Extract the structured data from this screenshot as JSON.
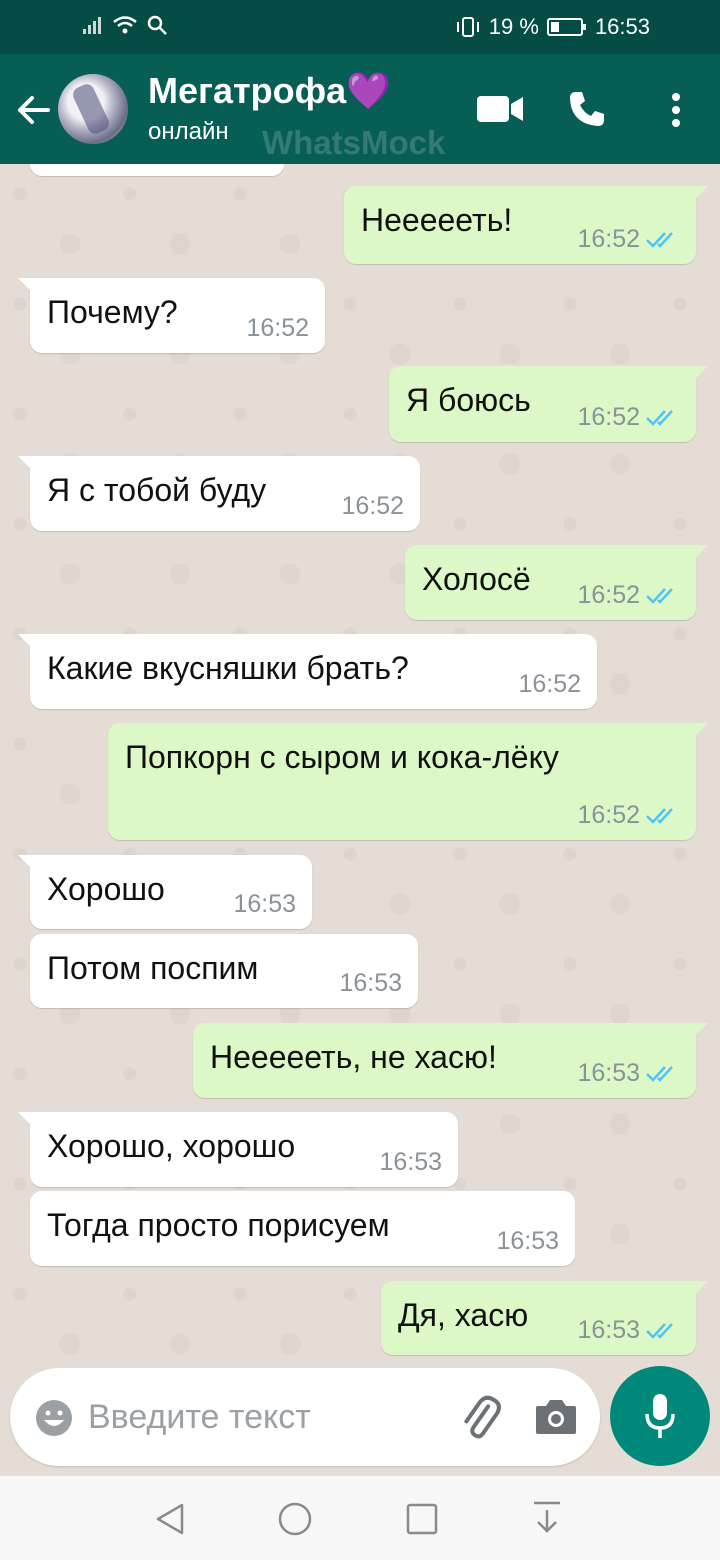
{
  "status_bar": {
    "battery_percent": "19 %",
    "time": "16:53"
  },
  "header": {
    "chat_name": "Мегатрофа💜",
    "status": "онлайн",
    "watermark": "WhatsMock"
  },
  "messages": [
    {
      "dir": "out",
      "text": "Неееееть!",
      "time": "16:52",
      "read": true
    },
    {
      "dir": "in",
      "text": "Почему?",
      "time": "16:52"
    },
    {
      "dir": "out",
      "text": "Я боюсь",
      "time": "16:52",
      "read": true
    },
    {
      "dir": "in",
      "text": "Я с тобой буду",
      "time": "16:52"
    },
    {
      "dir": "out",
      "text": "Холосё",
      "time": "16:52",
      "read": true
    },
    {
      "dir": "in",
      "text": "Какие вкусняшки брать?",
      "time": "16:52"
    },
    {
      "dir": "out",
      "text": "Попкорн с сыром и кока-лёку",
      "time": "16:52",
      "read": true
    },
    {
      "dir": "in",
      "text": "Хорошо",
      "time": "16:53"
    },
    {
      "dir": "in",
      "text": "Потом поспим",
      "time": "16:53"
    },
    {
      "dir": "out",
      "text": "Неееееть, не хасю!",
      "time": "16:53",
      "read": true
    },
    {
      "dir": "in",
      "text": "Хорошо, хорошо",
      "time": "16:53"
    },
    {
      "dir": "in",
      "text": "Тогда просто порисуем",
      "time": "16:53"
    },
    {
      "dir": "out",
      "text": "Дя, хасю",
      "time": "16:53",
      "read": true
    }
  ],
  "input": {
    "placeholder": "Введите текст"
  },
  "colors": {
    "header": "#075e54",
    "status_bar": "#054d44",
    "outgoing_bubble": "#dcf8c6",
    "incoming_bubble": "#ffffff",
    "read_tick": "#4fc3f7",
    "mic_button": "#00897b"
  }
}
